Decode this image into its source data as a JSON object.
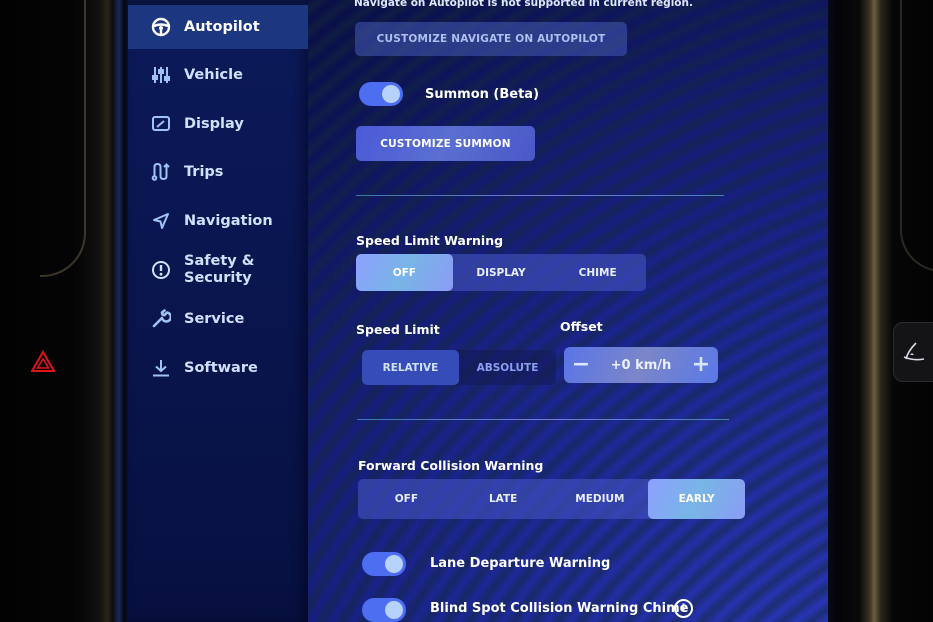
{
  "sidebar": {
    "items": [
      {
        "label": "Autopilot",
        "icon": "steering-wheel-icon",
        "active": true
      },
      {
        "label": "Vehicle",
        "icon": "sliders-icon",
        "active": false
      },
      {
        "label": "Display",
        "icon": "display-icon",
        "active": false
      },
      {
        "label": "Trips",
        "icon": "trips-icon",
        "active": false
      },
      {
        "label": "Navigation",
        "icon": "navigation-arrow-icon",
        "active": false
      },
      {
        "label": "Safety & Security",
        "icon": "exclamation-circle-icon",
        "active": false
      },
      {
        "label": "Service",
        "icon": "wrench-icon",
        "active": false
      },
      {
        "label": "Software",
        "icon": "download-icon",
        "active": false
      }
    ]
  },
  "autopilot": {
    "nav_note": "Navigate on Autopilot is not supported in current region.",
    "customize_nav_label": "CUSTOMIZE NAVIGATE ON AUTOPILOT",
    "summon": {
      "label": "Summon (Beta)",
      "enabled": true
    },
    "customize_summon_label": "CUSTOMIZE SUMMON",
    "speed_limit_warning": {
      "label": "Speed Limit Warning",
      "options": [
        "OFF",
        "DISPLAY",
        "CHIME"
      ],
      "selected": "OFF"
    },
    "speed_limit": {
      "label": "Speed Limit",
      "options": [
        "RELATIVE",
        "ABSOLUTE"
      ],
      "selected": "RELATIVE"
    },
    "offset": {
      "label": "Offset",
      "value": "+0 km/h",
      "minus": "−",
      "plus": "+"
    },
    "forward_collision_warning": {
      "label": "Forward Collision Warning",
      "options": [
        "OFF",
        "LATE",
        "MEDIUM",
        "EARLY"
      ],
      "selected": "EARLY"
    },
    "lane_departure_warning": {
      "label": "Lane Departure Warning",
      "enabled": true
    },
    "blind_spot_chime": {
      "label": "Blind Spot Collision Warning Chime",
      "enabled": true,
      "info": "i"
    }
  },
  "colors": {
    "accent": "#4d6ef0",
    "hazard": "#e0121a",
    "sidebar_active": "#1d3680"
  }
}
